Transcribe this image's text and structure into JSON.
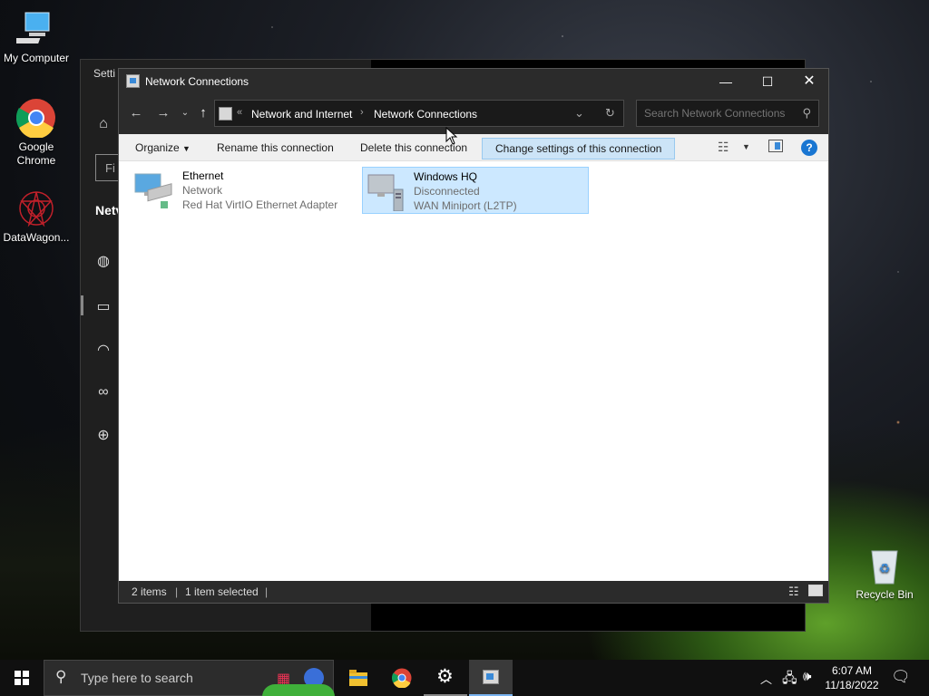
{
  "desktop": {
    "icons": [
      {
        "label": "My Computer",
        "icon": "computer-icon"
      },
      {
        "label": "Google Chrome",
        "icon": "chrome-icon"
      },
      {
        "label": "DataWagon...",
        "icon": "datawagon-icon"
      },
      {
        "label": "Recycle Bin",
        "icon": "recycle-bin-icon"
      }
    ]
  },
  "settings": {
    "title": "Setti",
    "find_placeholder": "Fi",
    "heading": "Netv"
  },
  "window": {
    "title": "Network Connections",
    "address": {
      "overflow": "«",
      "crumbs": [
        "Network and Internet",
        "Network Connections"
      ]
    },
    "search_placeholder": "Search Network Connections",
    "toolbar": {
      "organize": "Organize",
      "rename": "Rename this connection",
      "delete": "Delete this connection",
      "change": "Change settings of this connection"
    },
    "items": [
      {
        "name": "Ethernet",
        "status": "Network",
        "adapter": "Red Hat VirtIO Ethernet Adapter",
        "selected": false
      },
      {
        "name": "Windows HQ",
        "status": "Disconnected",
        "adapter": "WAN Miniport (L2TP)",
        "selected": true
      }
    ],
    "status": {
      "count": "2 items",
      "selected": "1 item selected"
    }
  },
  "taskbar": {
    "search_placeholder": "Type here to search",
    "time": "6:07 AM",
    "date": "11/18/2022"
  }
}
